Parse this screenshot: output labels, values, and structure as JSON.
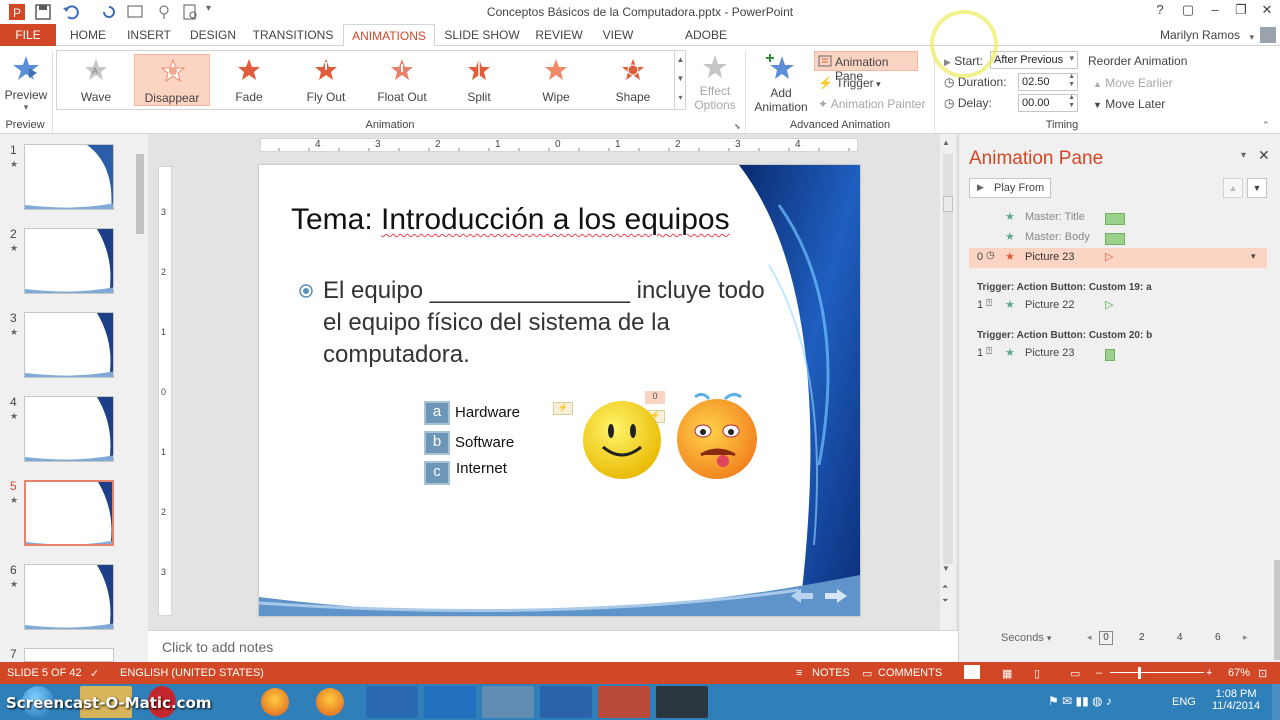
{
  "window": {
    "title": "Conceptos Básicos de la Computadora.pptx - PowerPoint",
    "help": "?",
    "user": "Marilyn Ramos"
  },
  "tabs": [
    "FILE",
    "HOME",
    "INSERT",
    "DESIGN",
    "TRANSITIONS",
    "ANIMATIONS",
    "SLIDE SHOW",
    "REVIEW",
    "VIEW",
    "ADOBE PRESENTER"
  ],
  "ribbon": {
    "preview": {
      "label": "Preview",
      "group": "Preview"
    },
    "gallery": [
      "Wave",
      "Disappear",
      "Fade",
      "Fly Out",
      "Float Out",
      "Split",
      "Wipe",
      "Shape"
    ],
    "effect_options": [
      "Effect",
      "Options"
    ],
    "animation_group": "Animation",
    "add_animation": [
      "Add",
      "Animation"
    ],
    "animation_pane": "Animation Pane",
    "trigger": "Trigger",
    "animation_painter": "Animation Painter",
    "advanced_group": "Advanced Animation",
    "start_label": "Start:",
    "start_value": "After Previous",
    "duration_label": "Duration:",
    "duration_value": "02.50",
    "delay_label": "Delay:",
    "delay_value": "00.00",
    "reorder": "Reorder Animation",
    "move_earlier": "Move Earlier",
    "move_later": "Move Later",
    "timing_group": "Timing"
  },
  "thumbnails": [
    "1",
    "2",
    "3",
    "4",
    "5",
    "6",
    "7"
  ],
  "selected_slide": 5,
  "slide": {
    "title_prefix": "Tema: ",
    "title_main": "Introducción a los equipos",
    "bullet_line1": "El equipo _______________ incluye todo",
    "bullet_line2": "el equipo físico del sistema de la",
    "bullet_line3": "computadora.",
    "options": [
      {
        "key": "a",
        "text": "Hardware"
      },
      {
        "key": "b",
        "text": "Software"
      },
      {
        "key": "c",
        "text": "Internet"
      }
    ],
    "tag_zero": "0"
  },
  "notes_placeholder": "Click to add notes",
  "ruler_h": [
    "4",
    "3",
    "2",
    "1",
    "0",
    "1",
    "2",
    "3",
    "4"
  ],
  "ruler_v": [
    "3",
    "2",
    "1",
    "0",
    "1",
    "2",
    "3"
  ],
  "anim_pane": {
    "title": "Animation Pane",
    "play_from": "Play From",
    "items": [
      {
        "index": "",
        "name": "Master: Title"
      },
      {
        "index": "",
        "name": "Master: Body"
      },
      {
        "index": "0",
        "name": "Picture 23"
      }
    ],
    "trigger1": "Trigger: Action Button: Custom 19: a",
    "trigger1_item": {
      "index": "1",
      "name": "Picture 22"
    },
    "trigger2": "Trigger: Action Button: Custom 20: b",
    "trigger2_item": {
      "index": "1",
      "name": "Picture 23"
    },
    "seconds": "Seconds",
    "timeline": [
      "0",
      "2",
      "4",
      "6"
    ]
  },
  "status": {
    "slide": "SLIDE 5 OF 42",
    "language": "ENGLISH (UNITED STATES)",
    "notes": "NOTES",
    "comments": "COMMENTS",
    "zoom": "67%"
  },
  "taskbar": {
    "watermark": "Screencast-O-Matic.com",
    "lang": "ENG",
    "time": "1:08 PM",
    "date": "11/4/2014"
  },
  "colors": {
    "accent": "#d24726",
    "taskbar": "#2f7fb9",
    "selection": "#fcd4c3"
  }
}
